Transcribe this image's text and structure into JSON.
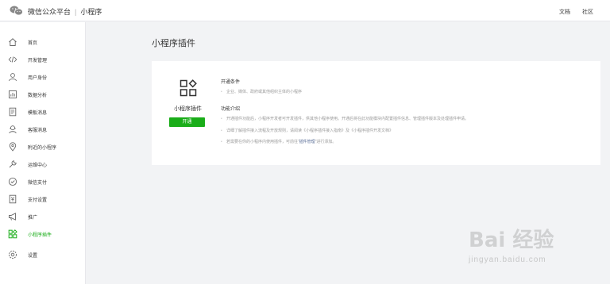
{
  "header": {
    "logo_icon": "wechat-icon",
    "brand_title": "微信公众平台",
    "separator": "|",
    "brand_subtitle": "小程序",
    "links": [
      "文档",
      "社区"
    ]
  },
  "sidebar": {
    "items": [
      {
        "label": "首页",
        "icon": "home-icon"
      },
      {
        "label": "开发管理",
        "icon": "code-icon"
      },
      {
        "label": "用户身份",
        "icon": "user-icon"
      },
      {
        "label": "数据分析",
        "icon": "chart-icon"
      },
      {
        "label": "模板消息",
        "icon": "document-icon"
      },
      {
        "label": "客服消息",
        "icon": "customer-service-icon"
      },
      {
        "label": "附近的小程序",
        "icon": "location-icon"
      },
      {
        "label": "运维中心",
        "icon": "wrench-icon"
      },
      {
        "label": "微信支付",
        "icon": "payment-icon"
      },
      {
        "label": "支付设置",
        "icon": "payment-settings-icon"
      },
      {
        "label": "推广",
        "icon": "megaphone-icon"
      },
      {
        "label": "小程序插件",
        "icon": "plugin-icon",
        "active": true
      },
      {
        "label": "设置",
        "icon": "gear-icon"
      }
    ]
  },
  "main": {
    "title": "小程序插件",
    "card": {
      "plugin_icon": "plugin-icon",
      "plugin_name": "小程序插件",
      "open_button": "开通",
      "conditions": {
        "title": "开通条件",
        "items": [
          "企业、媒体、政府或其他组织主体的小程序"
        ]
      },
      "intro": {
        "title": "功能介绍",
        "items": [
          "开通插件功能后，小程序开发者可开发插件，供其他小程序使用。开通后将在此功能模块内配置插件信息、管理插件版本及处理插件申请。",
          "详细了解插件接入流程及开放规则，请阅读《小程序插件接入指南》及《小程序插件开发文档》",
          {
            "before": "若需要在你的小程序内使用插件，可前往“",
            "link": "插件管理",
            "after": "”进行添加。"
          }
        ]
      }
    }
  },
  "watermark": {
    "main": "Bai 经验",
    "sub": "jingyan.baidu.com"
  },
  "colors": {
    "accent": "#1aad19",
    "link": "#576b95",
    "background": "#f2f3f5"
  }
}
